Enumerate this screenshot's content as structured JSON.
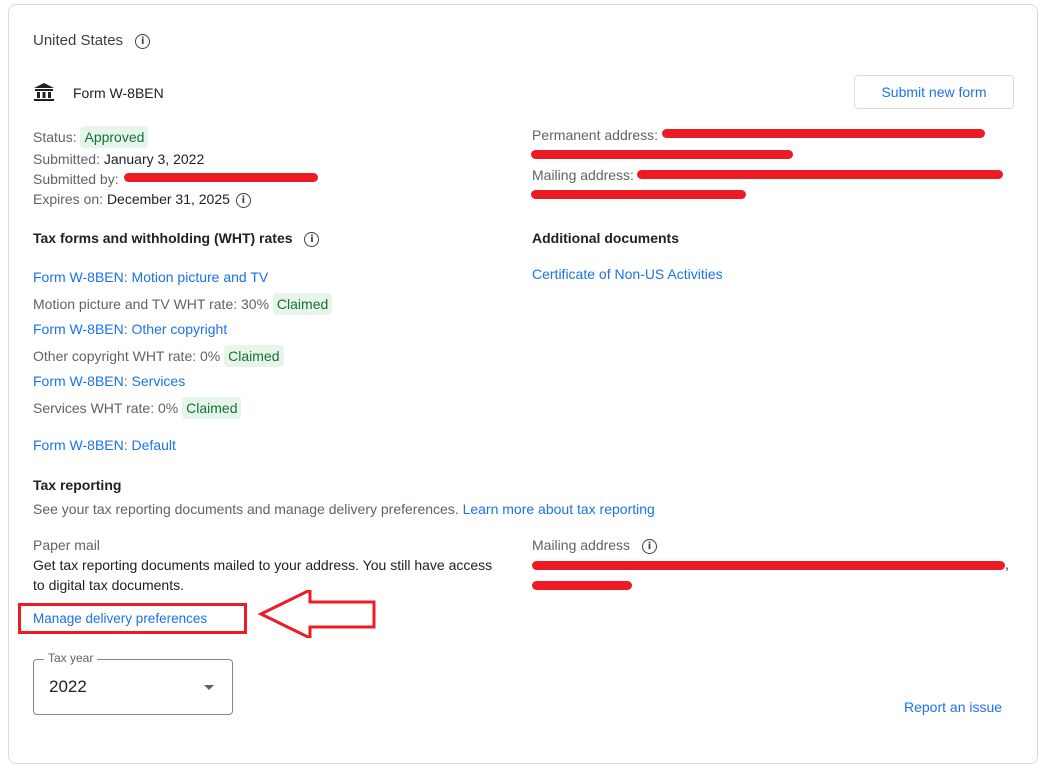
{
  "header": {
    "country": "United States",
    "form_name": "Form W-8BEN",
    "submit_button": "Submit new form"
  },
  "form_details": {
    "status_label": "Status:",
    "status_value": "Approved",
    "submitted_label": "Submitted:",
    "submitted_value": "January 3, 2022",
    "submitted_by_label": "Submitted by:",
    "submitted_by_value": "[redacted]",
    "expires_label": "Expires on:",
    "expires_value": "December 31, 2025"
  },
  "addresses": {
    "permanent_label": "Permanent address:",
    "permanent_value": "[redacted]",
    "mailing_label": "Mailing address:",
    "mailing_value": "[redacted]"
  },
  "tax_forms": {
    "heading": "Tax forms and withholding (WHT) rates",
    "items": [
      {
        "link": "Form W-8BEN: Motion picture and TV",
        "rate": "Motion picture and TV WHT rate: 30%",
        "badge": "Claimed"
      },
      {
        "link": "Form W-8BEN: Other copyright",
        "rate": "Other copyright WHT rate: 0%",
        "badge": "Claimed"
      },
      {
        "link": "Form W-8BEN: Services",
        "rate": "Services WHT rate: 0%",
        "badge": "Claimed"
      }
    ],
    "default_link": "Form W-8BEN: Default"
  },
  "additional_documents": {
    "heading": "Additional documents",
    "link": "Certificate of Non-US Activities"
  },
  "tax_reporting": {
    "heading": "Tax reporting",
    "description": "See your tax reporting documents and manage delivery preferences.",
    "learn_more": "Learn more about tax reporting",
    "paper_mail_label": "Paper mail",
    "paper_mail_desc_1": "Get tax reporting documents mailed to your address. You still have access",
    "paper_mail_desc_2": "to digital tax documents.",
    "manage_link": "Manage delivery preferences",
    "mailing_address_label": "Mailing address",
    "mailing_address_value": "[redacted]",
    "mailing_address_tail": ","
  },
  "tax_year": {
    "label": "Tax year",
    "value": "2022"
  },
  "footer": {
    "report_issue": "Report an issue"
  },
  "colors": {
    "link": "#1a73e8",
    "approved_bg": "#e6f4ea",
    "approved_text": "#137333",
    "annotation": "#ed1c24"
  }
}
